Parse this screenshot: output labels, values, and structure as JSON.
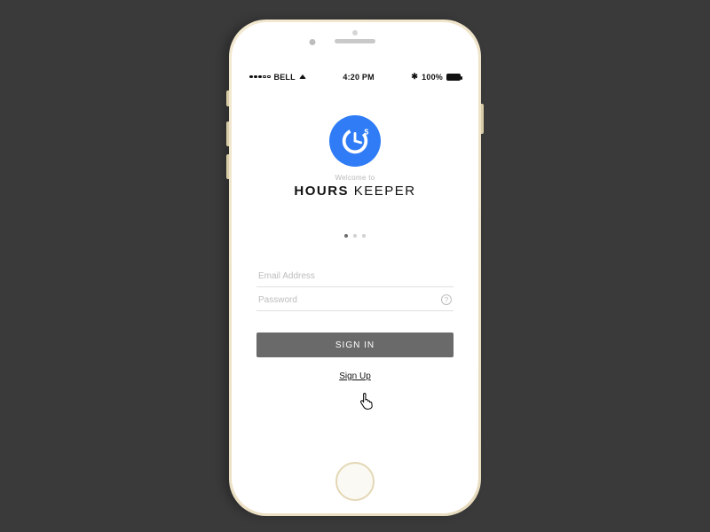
{
  "statusBar": {
    "carrier": "BELL",
    "time": "4:20 PM",
    "batteryPercent": "100%"
  },
  "hero": {
    "welcome": "Welcome to",
    "brandBold": "HOURS",
    "brandLight": "KEEPER"
  },
  "form": {
    "emailPlaceholder": "Email Address",
    "passwordPlaceholder": "Password",
    "helpGlyph": "?"
  },
  "actions": {
    "signIn": "SIGN IN",
    "signUp": "Sign Up"
  },
  "bluetoothGlyph": "⚇"
}
